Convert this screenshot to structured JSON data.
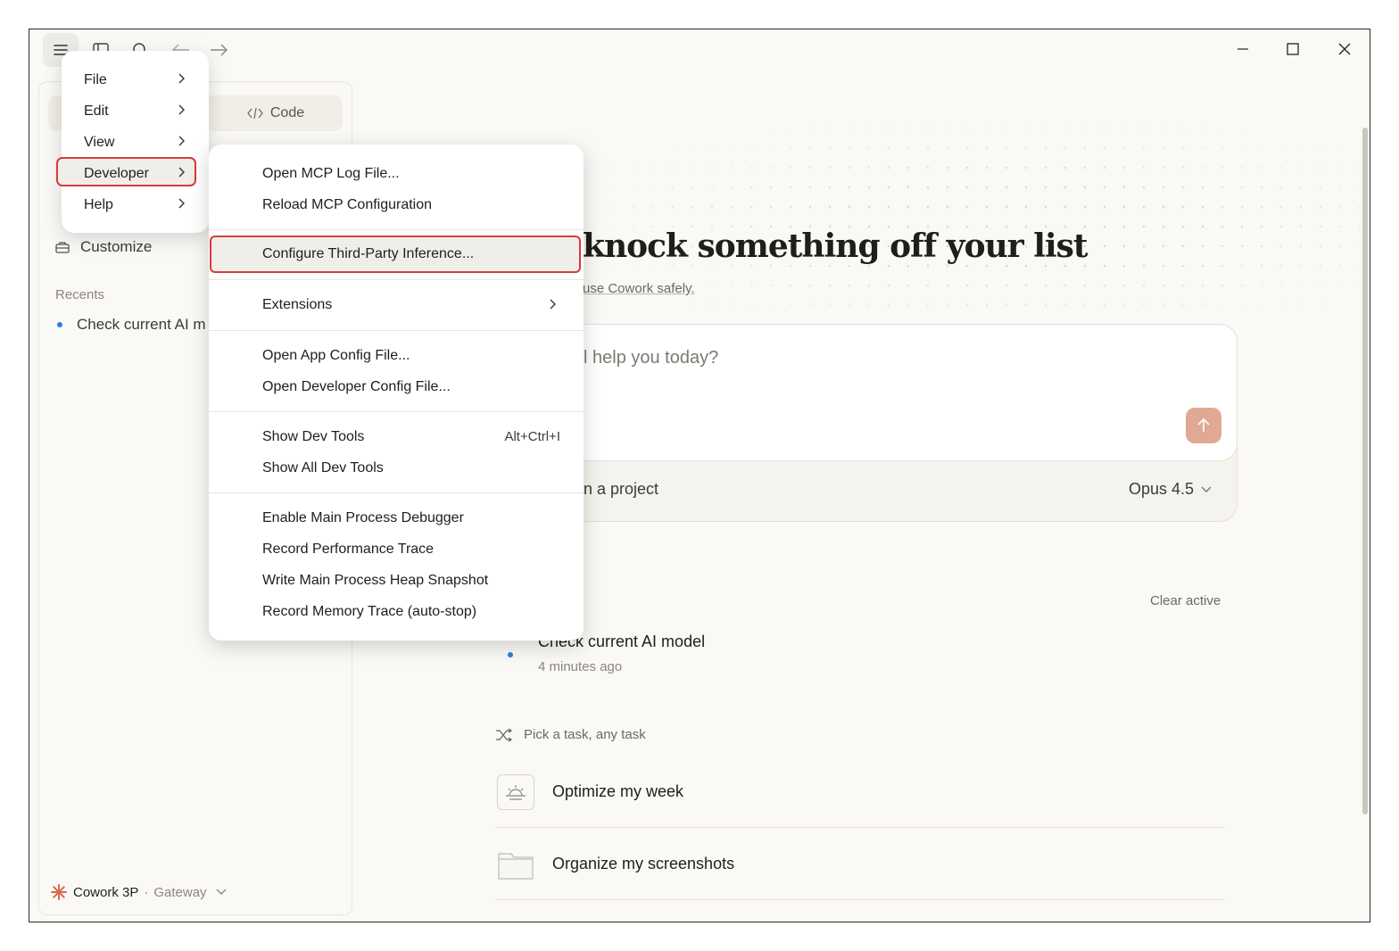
{
  "menu": {
    "items": [
      {
        "label": "File"
      },
      {
        "label": "Edit"
      },
      {
        "label": "View"
      },
      {
        "label": "Developer"
      },
      {
        "label": "Help"
      }
    ]
  },
  "developer_menu": {
    "items": [
      {
        "label": "Open MCP Log File..."
      },
      {
        "label": "Reload MCP Configuration"
      },
      {
        "label": "Configure Third-Party Inference..."
      },
      {
        "label": "Extensions"
      },
      {
        "label": "Open App Config File..."
      },
      {
        "label": "Open Developer Config File..."
      },
      {
        "label": "Show Dev Tools",
        "shortcut": "Alt+Ctrl+I"
      },
      {
        "label": "Show All Dev Tools"
      },
      {
        "label": "Enable Main Process Debugger"
      },
      {
        "label": "Record Performance Trace"
      },
      {
        "label": "Write Main Process Heap Snapshot"
      },
      {
        "label": "Record Memory Trace (auto-stop)"
      }
    ]
  },
  "sidebar": {
    "code_tab": "Code",
    "customize": "Customize",
    "recents_label": "Recents",
    "recent_item": "Check current AI m",
    "footer_name": "Cowork 3P",
    "footer_sep": "·",
    "footer_gateway": "Gateway"
  },
  "main": {
    "headline": "knock something off your list",
    "subline_pre": "",
    "subline_link": "use Cowork safely.",
    "composer_placeholder": "l help you today?",
    "project_row": "n a project",
    "model": "Opus 4.5",
    "clear_active": "Clear active",
    "active_task_title": "Check current AI model",
    "active_task_time": "4 minutes ago",
    "pick_label": "Pick a task, any task",
    "tasks": [
      {
        "label": "Optimize my week",
        "icon": "sunrise-icon"
      },
      {
        "label": "Organize my screenshots",
        "icon": "folder-icon"
      }
    ]
  },
  "colors": {
    "accent": "#e0a993",
    "highlight_border": "#d93a3a",
    "status_dot": "#2f7ce3"
  }
}
